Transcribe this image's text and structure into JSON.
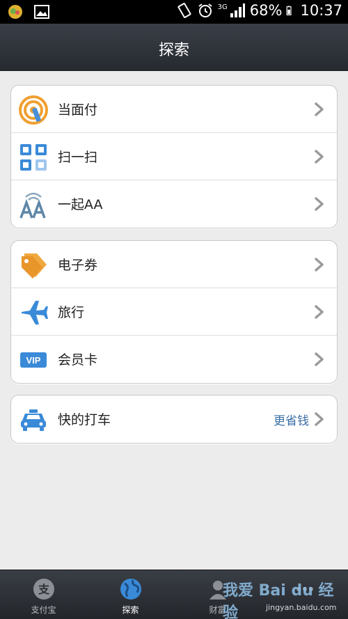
{
  "status_bar": {
    "battery": "68%",
    "time": "10:37",
    "network": "3G"
  },
  "header": {
    "title": "探索"
  },
  "groups": [
    {
      "items": [
        {
          "label": "当面付",
          "icon": "face-pay-icon"
        },
        {
          "label": "扫一扫",
          "icon": "qr-scan-icon"
        },
        {
          "label": "一起AA",
          "icon": "aa-split-icon"
        }
      ]
    },
    {
      "items": [
        {
          "label": "电子券",
          "icon": "coupon-tag-icon"
        },
        {
          "label": "旅行",
          "icon": "airplane-icon"
        },
        {
          "label": "会员卡",
          "icon": "vip-card-icon"
        }
      ]
    },
    {
      "items": [
        {
          "label": "快的打车",
          "extra": "更省钱",
          "icon": "taxi-icon"
        }
      ]
    }
  ],
  "tabbar": {
    "tabs": [
      {
        "label": "支付宝",
        "icon": "alipay-icon"
      },
      {
        "label": "探索",
        "icon": "globe-icon",
        "active": true
      },
      {
        "label": "财富",
        "icon": "wealth-icon"
      },
      {
        "label": "",
        "icon": "more-icon"
      }
    ]
  },
  "watermark": {
    "text": "我爱 Bai du 经验",
    "sub": "jingyan.baidu.com"
  },
  "colors": {
    "accent": "#3a6ea5",
    "header": "#2f333a",
    "background": "#ececec"
  }
}
